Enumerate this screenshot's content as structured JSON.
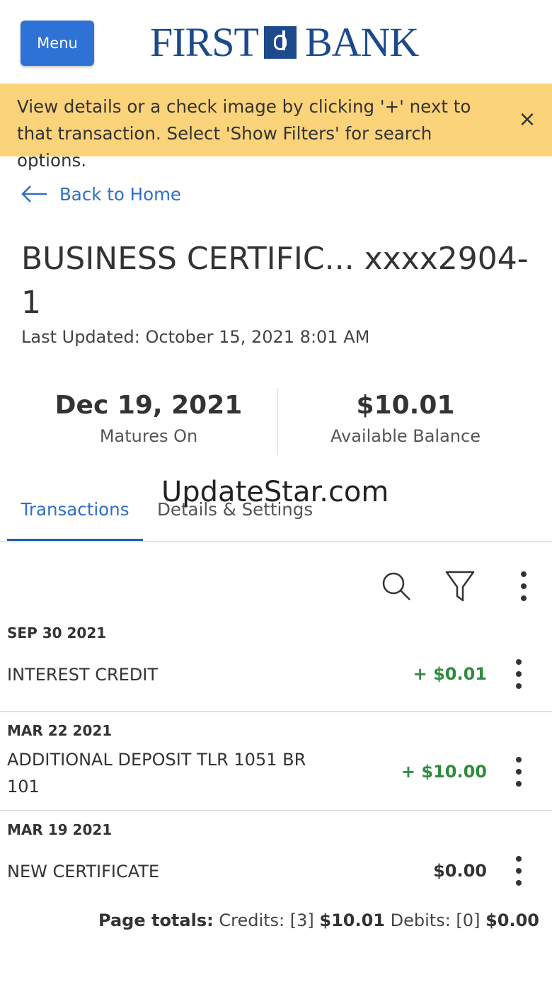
{
  "header": {
    "menu_label": "Menu",
    "logo_left": "FIRST",
    "logo_right": "BANK"
  },
  "banner": {
    "message": "View details or a check image by clicking '+' next to that transaction. Select 'Show Filters' for search options.",
    "close_glyph": "×"
  },
  "nav": {
    "back_label": "Back to Home"
  },
  "account": {
    "name": "BUSINESS CERTIFIC...",
    "number": "xxxx2904-1",
    "last_updated": "Last Updated: October 15, 2021 8:01 AM"
  },
  "stats": {
    "maturity_value": "Dec 19, 2021",
    "maturity_label": "Matures On",
    "balance_value": "$10.01",
    "balance_label": "Available Balance"
  },
  "tabs": [
    {
      "label": "Transactions",
      "active": true
    },
    {
      "label": "Details & Settings",
      "active": false
    }
  ],
  "watermark": "UpdateStar.com",
  "transactions": [
    {
      "date": "SEP 30 2021",
      "description": "INTEREST CREDIT",
      "amount": "+ $0.01"
    },
    {
      "date": "MAR 22 2021",
      "description": "ADDITIONAL DEPOSIT TLR 1051 BR 101",
      "amount": "+ $10.00"
    },
    {
      "date": "MAR 19 2021",
      "description": "NEW CERTIFICATE",
      "amount": "$0.00"
    }
  ],
  "totals": {
    "label": "Page totals:",
    "credits_label": "Credits: [3]",
    "credits_value": "$10.01",
    "debits_label": "Debits: [0]",
    "debits_value": "$0.00"
  },
  "colors": {
    "brand_blue": "#1c4a8c",
    "button_blue": "#2f72d6",
    "banner_yellow": "#fbd37a",
    "link_blue": "#2e6fc9",
    "credit_green": "#2e8b3e"
  },
  "icons": [
    "menu-button",
    "bank-logo-mark",
    "close-icon",
    "arrow-left-icon",
    "search-icon",
    "filter-icon",
    "more-vertical-icon"
  ]
}
